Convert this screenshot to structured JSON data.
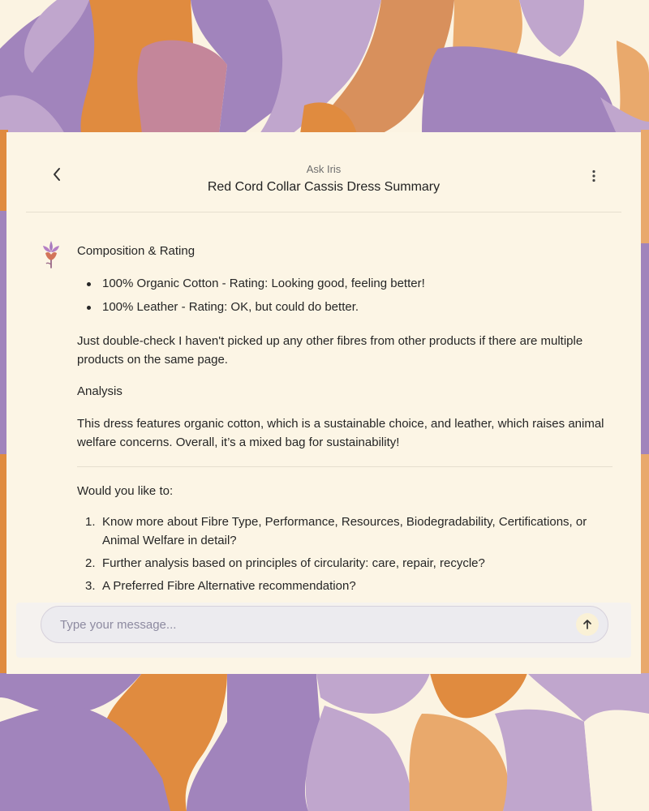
{
  "header": {
    "subtitle": "Ask Iris",
    "title": "Red Cord Collar Cassis Dress Summary",
    "back_icon": "chevron-left-icon",
    "menu_icon": "kebab-menu-icon"
  },
  "message": {
    "avatar_icon": "iris-flower-icon",
    "heading": "Composition & Rating",
    "bullets": [
      "100% Organic Cotton - Rating: Looking good, feeling better!",
      "100% Leather - Rating: OK, but could do better."
    ],
    "note": "Just double-check I haven't picked up any other fibres from other products if there are multiple products on the same page.",
    "analysis_heading": "Analysis",
    "analysis_text": "This dress features organic cotton, which is a sustainable choice, and leather, which raises animal welfare concerns. Overall, it’s a mixed bag for sustainability!",
    "prompt": "Would you like to:",
    "options": [
      {
        "num": "1.",
        "text": "Know more about Fibre Type, Performance, Resources, Biodegradability, Certifications, or Animal Welfare in detail?"
      },
      {
        "num": "2.",
        "text": "Further analysis based on principles of circularity: care, repair, recycle?"
      },
      {
        "num": "3.",
        "text": "A Preferred Fibre Alternative recommendation?"
      }
    ]
  },
  "composer": {
    "placeholder": "Type your message...",
    "send_icon": "arrow-up-icon"
  },
  "colors": {
    "background": "#fbf3e2",
    "purple": "#a184bc",
    "light_purple": "#c0a6cd",
    "orange": "#e08b3f",
    "light_orange": "#e9a96c",
    "card": "#fcf5e5"
  }
}
